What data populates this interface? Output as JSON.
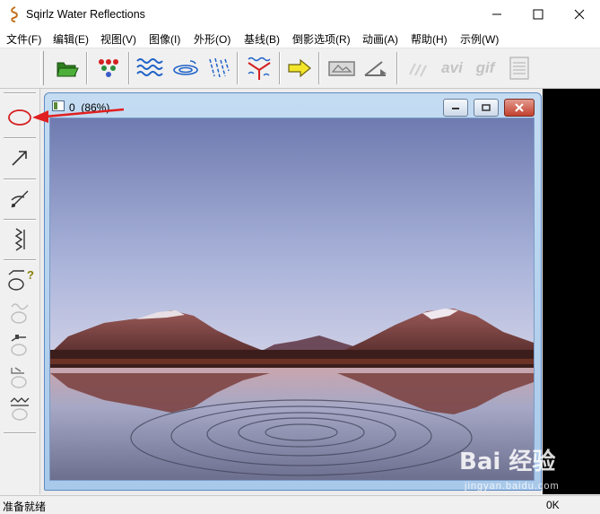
{
  "app": {
    "title": "Sqirlz Water Reflections"
  },
  "menu": [
    "文件(F)",
    "编辑(E)",
    "视图(V)",
    "图像(I)",
    "外形(O)",
    "基线(B)",
    "倒影选项(R)",
    "动画(A)",
    "帮助(H)",
    "示例(W)"
  ],
  "toolbar": {
    "icons": [
      "open-folder-icon",
      "color-dots-icon",
      "waves-icon",
      "ripples-icon",
      "rain-icon",
      "baseline-icon",
      "arrow-right-icon",
      "reflection-frame-icon",
      "angle-icon",
      "streaks-icon",
      "avi-icon",
      "gif-icon",
      "document-icon"
    ],
    "avi_label": "avi",
    "gif_label": "gif"
  },
  "toolbox": {
    "icons": [
      "ellipse-icon",
      "arrow-icon",
      "line-cut-icon",
      "zigzag-icon",
      "shape-help-icon",
      "wave-shape-icon",
      "wave-shape-2-icon",
      "wave-shape-3-icon",
      "wave-shape-4-icon"
    ],
    "help_mark": "?"
  },
  "document": {
    "title": "0  (86%)"
  },
  "status": {
    "left": "准备就绪",
    "right": "0K"
  },
  "watermark": {
    "logo": "Bai 经验",
    "url": "jingyan.baidu.com"
  },
  "colors": {
    "window_blue": "#a9c9ea",
    "close_red": "#c84a3c",
    "annotation_red": "#e02020"
  }
}
